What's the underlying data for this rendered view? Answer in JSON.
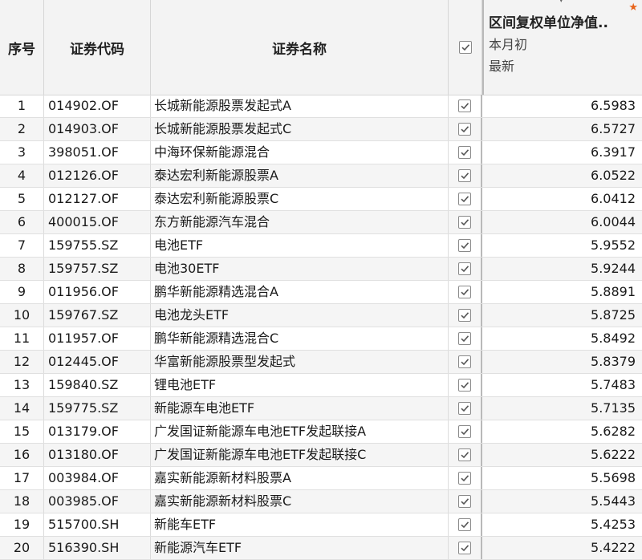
{
  "header": {
    "seq": "序号",
    "code": "证券代码",
    "name": "证券名称",
    "value_title": "区间复权单位净值..",
    "value_sub1": "本月初",
    "value_sub2": "最新",
    "star": "★"
  },
  "rows": [
    {
      "seq": "1",
      "code": "014902.OF",
      "name": "长城新能源股票发起式A",
      "value": "6.5983",
      "checked": true
    },
    {
      "seq": "2",
      "code": "014903.OF",
      "name": "长城新能源股票发起式C",
      "value": "6.5727",
      "checked": true
    },
    {
      "seq": "3",
      "code": "398051.OF",
      "name": "中海环保新能源混合",
      "value": "6.3917",
      "checked": true
    },
    {
      "seq": "4",
      "code": "012126.OF",
      "name": "泰达宏利新能源股票A",
      "value": "6.0522",
      "checked": true
    },
    {
      "seq": "5",
      "code": "012127.OF",
      "name": "泰达宏利新能源股票C",
      "value": "6.0412",
      "checked": true
    },
    {
      "seq": "6",
      "code": "400015.OF",
      "name": "东方新能源汽车混合",
      "value": "6.0044",
      "checked": true
    },
    {
      "seq": "7",
      "code": "159755.SZ",
      "name": "电池ETF",
      "value": "5.9552",
      "checked": true
    },
    {
      "seq": "8",
      "code": "159757.SZ",
      "name": "电池30ETF",
      "value": "5.9244",
      "checked": true
    },
    {
      "seq": "9",
      "code": "011956.OF",
      "name": "鹏华新能源精选混合A",
      "value": "5.8891",
      "checked": true
    },
    {
      "seq": "10",
      "code": "159767.SZ",
      "name": "电池龙头ETF",
      "value": "5.8725",
      "checked": true
    },
    {
      "seq": "11",
      "code": "011957.OF",
      "name": "鹏华新能源精选混合C",
      "value": "5.8492",
      "checked": true
    },
    {
      "seq": "12",
      "code": "012445.OF",
      "name": "华富新能源股票型发起式",
      "value": "5.8379",
      "checked": true
    },
    {
      "seq": "13",
      "code": "159840.SZ",
      "name": "锂电池ETF",
      "value": "5.7483",
      "checked": true
    },
    {
      "seq": "14",
      "code": "159775.SZ",
      "name": "新能源车电池ETF",
      "value": "5.7135",
      "checked": true
    },
    {
      "seq": "15",
      "code": "013179.OF",
      "name": "广发国证新能源车电池ETF发起联接A",
      "value": "5.6282",
      "checked": true
    },
    {
      "seq": "16",
      "code": "013180.OF",
      "name": "广发国证新能源车电池ETF发起联接C",
      "value": "5.6222",
      "checked": true
    },
    {
      "seq": "17",
      "code": "003984.OF",
      "name": "嘉实新能源新材料股票A",
      "value": "5.5698",
      "checked": true
    },
    {
      "seq": "18",
      "code": "003985.OF",
      "name": "嘉实新能源新材料股票C",
      "value": "5.5443",
      "checked": true
    },
    {
      "seq": "19",
      "code": "515700.SH",
      "name": "新能车ETF",
      "value": "5.4253",
      "checked": true
    },
    {
      "seq": "20",
      "code": "516390.SH",
      "name": "新能源汽车ETF",
      "value": "5.4222",
      "checked": true
    }
  ],
  "colors": {
    "star": "#e8641b",
    "header_bg": "#f3f3f3",
    "stripe": "#f5f5f5"
  }
}
